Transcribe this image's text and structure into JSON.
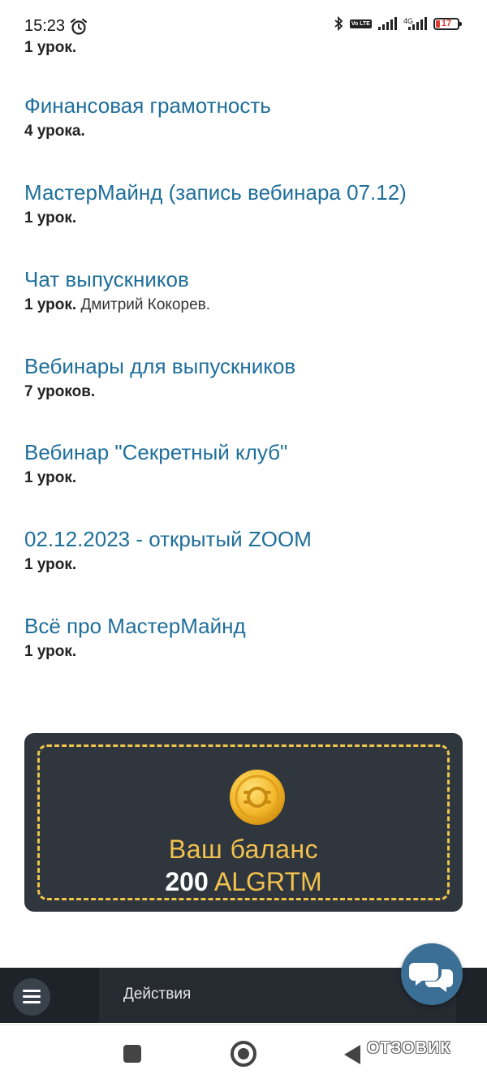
{
  "status_bar": {
    "time": "15:23",
    "battery_text": "17",
    "battery_level_percent": 17,
    "network_type": "4G",
    "volte": "Vo LTE"
  },
  "top_partial": {
    "meta": "1 урок."
  },
  "courses": [
    {
      "title": "Финансовая грамотность",
      "lessons": "4 урока.",
      "author": ""
    },
    {
      "title": "МастерМайнд (запись вебинара 07.12)",
      "lessons": "1 урок.",
      "author": ""
    },
    {
      "title": "Чат выпускников",
      "lessons": "1 урок.",
      "author": "Дмитрий Кокорев."
    },
    {
      "title": "Вебинары для выпускников",
      "lessons": "7 уроков.",
      "author": ""
    },
    {
      "title": "Вебинар \"Секретный клуб\"",
      "lessons": "1 урок.",
      "author": ""
    },
    {
      "title": "02.12.2023 - открытый ZOOM",
      "lessons": "1 урок.",
      "author": ""
    },
    {
      "title": "Всё про МастерМайнд",
      "lessons": "1 урок.",
      "author": ""
    }
  ],
  "balance": {
    "label": "Ваш баланс",
    "amount": "200",
    "currency": "ALGRTM"
  },
  "action_bar": {
    "actions_label": "Действия"
  },
  "watermark": "ОТЗОВИК",
  "colors": {
    "link": "#1f6f9b",
    "card_bg": "#2f363d",
    "accent_gold": "#f2c14e",
    "chat_fab": "#3b6f96"
  }
}
